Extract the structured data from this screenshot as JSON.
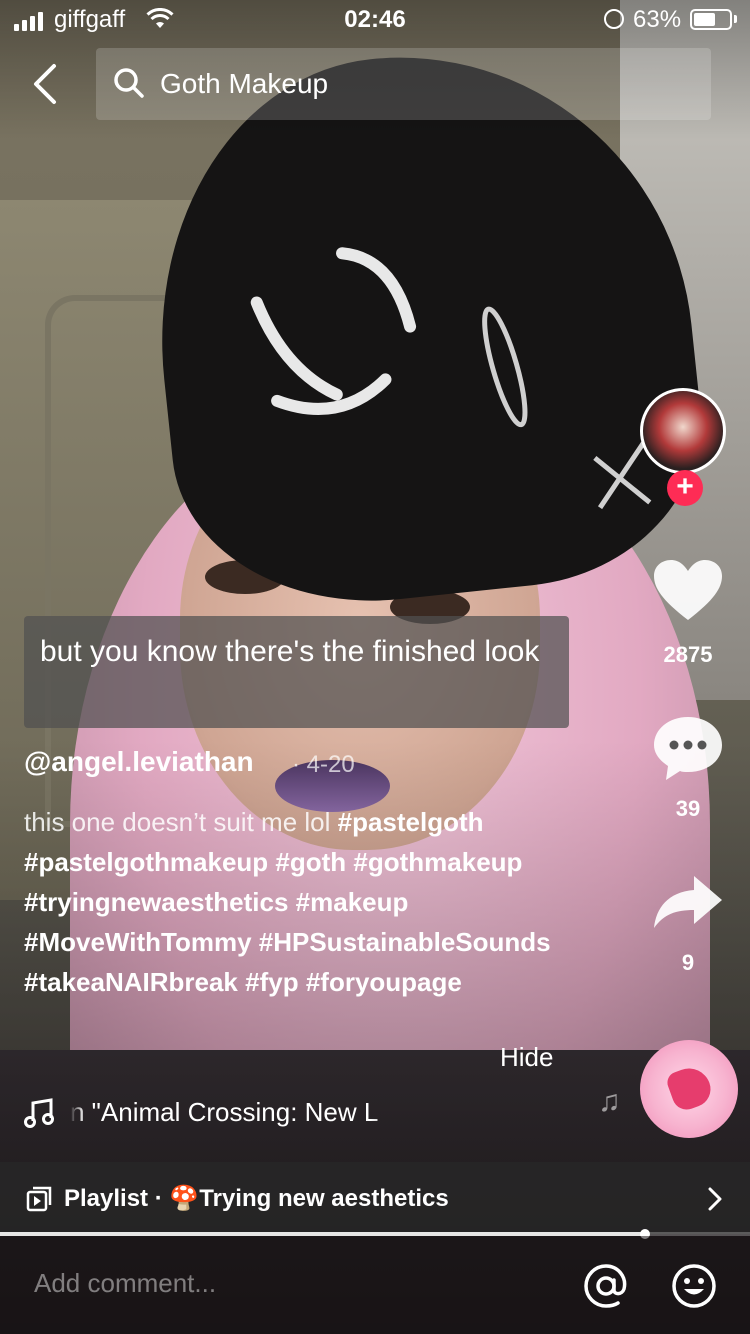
{
  "status_bar": {
    "carrier": "giffgaff",
    "time": "02:46",
    "battery_percent": "63%",
    "battery_level": 0.63
  },
  "search": {
    "query": "Goth Makeup"
  },
  "caption_overlay": {
    "text": "but you know there's the finished look"
  },
  "actions": {
    "likes": "2875",
    "comments": "39",
    "shares": "9"
  },
  "post": {
    "username": "@angel.leviathan",
    "date": "· 4-20",
    "description_plain": "this one doesn’t suit me lol ",
    "hashtags": [
      "#pastelgoth",
      "#pastelgothmakeup",
      "#goth",
      "#gothmakeup",
      "#tryingnewaesthetics",
      "#makeup",
      "#MoveWithTommy",
      "#HPSustainableSounds",
      "#takeaNAIRbreak",
      "#fyp",
      "#foryoupage"
    ],
    "hide_label": "Hide",
    "music": "n \"Animal Crossing: New L"
  },
  "playlist": {
    "label": "Playlist · ",
    "emoji": "🍄",
    "name": "Trying new aesthetics"
  },
  "playback_progress": 0.86,
  "comment": {
    "placeholder": "Add comment..."
  },
  "colors": {
    "follow": "#fe2c55",
    "playlist_bg": "#282828"
  },
  "icons": [
    "back-icon",
    "search-icon",
    "heart-icon",
    "comment-icon",
    "share-icon",
    "music-note-icon",
    "playlist-icon",
    "chevron-right-icon",
    "at-icon",
    "emoji-icon"
  ]
}
